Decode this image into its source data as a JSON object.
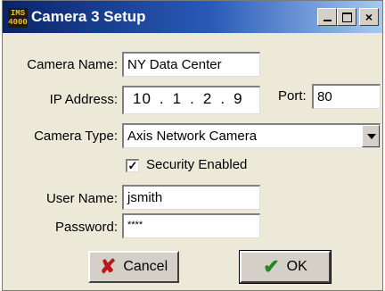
{
  "window": {
    "title": "Camera 3 Setup",
    "app_icon_text": "IMS\n4000"
  },
  "title_buttons": {
    "minimize_icon": "minimize-icon",
    "maximize_icon": "maximize-icon",
    "close_glyph": "×"
  },
  "form": {
    "camera_name_label": "Camera Name:",
    "camera_name_value": "NY Data Center",
    "ip_label": "IP Address:",
    "ip_segments": [
      "10",
      "1",
      "2",
      "9"
    ],
    "port_label": "Port:",
    "port_value": "80",
    "camera_type_label": "Camera Type:",
    "camera_type_value": "Axis Network Camera",
    "security_checked_glyph": "✓",
    "security_label": "Security Enabled",
    "user_name_label": "User Name:",
    "user_name_value": "jsmith",
    "password_label": "Password:",
    "password_value": "****"
  },
  "buttons": {
    "cancel_icon": "✘",
    "cancel_label": "Cancel",
    "ok_icon": "✔",
    "ok_label": "OK"
  },
  "colors": {
    "title_bar_start": "#0a246a",
    "window_bg": "#ece9d8",
    "cancel_icon": "#c0151b",
    "ok_icon": "#1f8a1f"
  }
}
